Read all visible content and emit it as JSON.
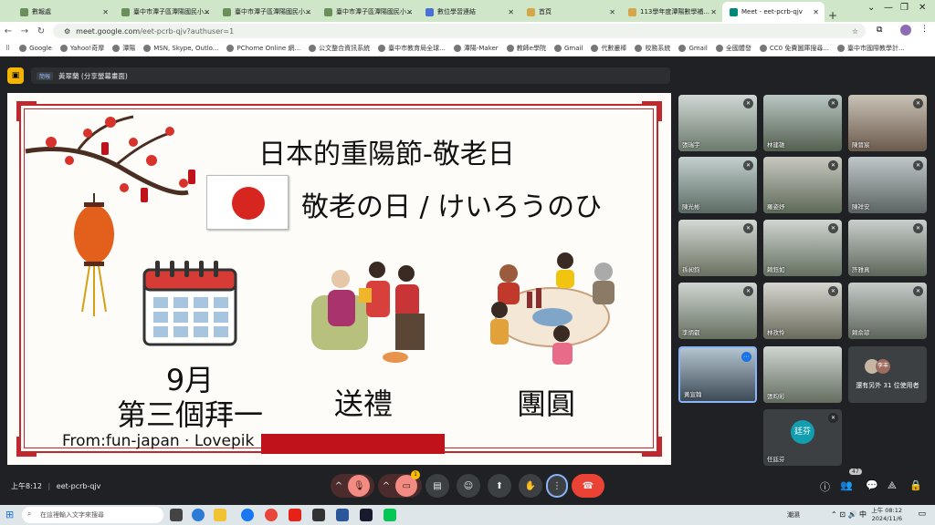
{
  "browser": {
    "tabs": [
      {
        "label": "數報處"
      },
      {
        "label": "臺中市潭子區潭陽國民小..."
      },
      {
        "label": "臺中市潭子區潭陽國民小..."
      },
      {
        "label": "臺中市潭子區潭陽國民小..."
      },
      {
        "label": "數位學習連結"
      },
      {
        "label": "首頁"
      },
      {
        "label": "113學年度潭陽數學補..."
      },
      {
        "label": "Meet - eet-pcrb-qjv"
      }
    ],
    "new_tab": "+",
    "url_host": "meet.google.com",
    "url_path": "/eet-pcrb-qjv?authuser=1",
    "bookmarks": [
      "Google",
      "Yahoo!奇摩",
      "潭陽",
      "MSN, Skype, Outlo...",
      "PChome Online 網...",
      "公文整合資訊系統",
      "臺中市教育局全球...",
      "潭陽-Maker",
      "教師e學院",
      "Gmail",
      "代數叢棒",
      "校務系統",
      "Gmail",
      "全國體發",
      "CC0 免費圖庫搜尋...",
      "臺中市國際教學計..."
    ]
  },
  "meet": {
    "presenter_badge": "簡報",
    "presenter_name": "黃翠蘭 (分享螢幕畫面)",
    "meeting_time": "上午8:12",
    "meeting_code": "eet-pcrb-qjv",
    "raise_hand_badge": "1",
    "people_count": "47",
    "more_participants_text": "還有另外 31 位使用者",
    "participants": [
      {
        "name": "張瑞宇"
      },
      {
        "name": "林建雄"
      },
      {
        "name": "陳晉宸"
      },
      {
        "name": "陳光彬"
      },
      {
        "name": "羅姿妤"
      },
      {
        "name": "陳祥安"
      },
      {
        "name": "孫昶鈞"
      },
      {
        "name": "賴鈺如"
      },
      {
        "name": "許雅真"
      },
      {
        "name": "李炳叡"
      },
      {
        "name": "林孜怜"
      },
      {
        "name": "賴俞諺"
      },
      {
        "name": "黃宣翰"
      },
      {
        "name": "張昀彩"
      },
      {
        "name": "任廷芬"
      }
    ],
    "ren_initials": "廷芬",
    "more_avatar_label": "李丰"
  },
  "slide": {
    "title": "日本的重陽節-敬老日",
    "subtitle": "敬老の日 / けいろうのひ",
    "caption_date_1": "9月",
    "caption_date_2": "第三個拜一",
    "caption_gift": "送禮",
    "caption_reunion": "團圓",
    "credit": "From:fun-japan · Lovepik"
  },
  "taskbar": {
    "search_placeholder": "在這裡輸入文字來搜尋",
    "weather": "潮濕",
    "clock_time": "上午 08:12",
    "clock_date": "2024/11/6"
  },
  "colors": {
    "slide_red": "#c0282d",
    "meet_bg": "#202124",
    "end_call": "#ea4335",
    "tab_bar": "#cfe6c9"
  }
}
